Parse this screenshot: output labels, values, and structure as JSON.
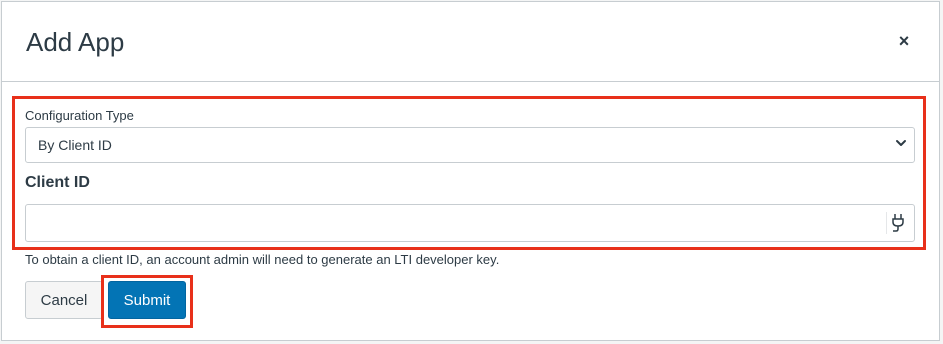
{
  "dialog": {
    "title": "Add App",
    "close_label": "×"
  },
  "form": {
    "config_type_label": "Configuration Type",
    "config_type_value": "By Client ID",
    "client_id_label": "Client ID",
    "client_id_value": "",
    "help_text": "To obtain a client ID, an account admin will need to generate an LTI developer key."
  },
  "actions": {
    "cancel_label": "Cancel",
    "submit_label": "Submit"
  },
  "colors": {
    "highlight": "#e8301a",
    "primary": "#0374b5",
    "text": "#2d3b45"
  },
  "icons": {
    "close": "close-icon",
    "chevron": "chevron-down-icon",
    "plug": "plug-icon"
  }
}
